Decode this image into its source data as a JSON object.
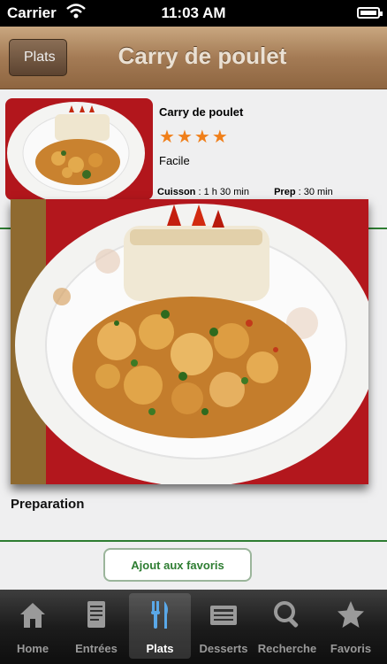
{
  "status_bar": {
    "carrier": "Carrier",
    "time": "11:03 AM"
  },
  "nav": {
    "back_label": "Plats",
    "title": "Carry de poulet"
  },
  "recipe": {
    "name": "Carry de poulet",
    "rating": 4,
    "difficulty": "Facile",
    "cook_label": "Cuisson",
    "cook_time": " : 1 h 30 min",
    "prep_label": "Prep",
    "prep_time": " : 30 min"
  },
  "section": {
    "preparation_label": "Preparation"
  },
  "actions": {
    "favorite_label": "Ajout aux favoris"
  },
  "tabs": [
    {
      "label": "Home",
      "icon": "home-icon"
    },
    {
      "label": "Entrées",
      "icon": "document-icon"
    },
    {
      "label": "Plats",
      "icon": "cutlery-icon",
      "active": true
    },
    {
      "label": "Desserts",
      "icon": "newspaper-icon"
    },
    {
      "label": "Recherche",
      "icon": "search-icon"
    },
    {
      "label": "Favoris",
      "icon": "star-icon"
    }
  ],
  "colors": {
    "accent_green": "#2e7d32",
    "star_orange": "#f07f1a",
    "nav_brown": "#a47b55"
  }
}
